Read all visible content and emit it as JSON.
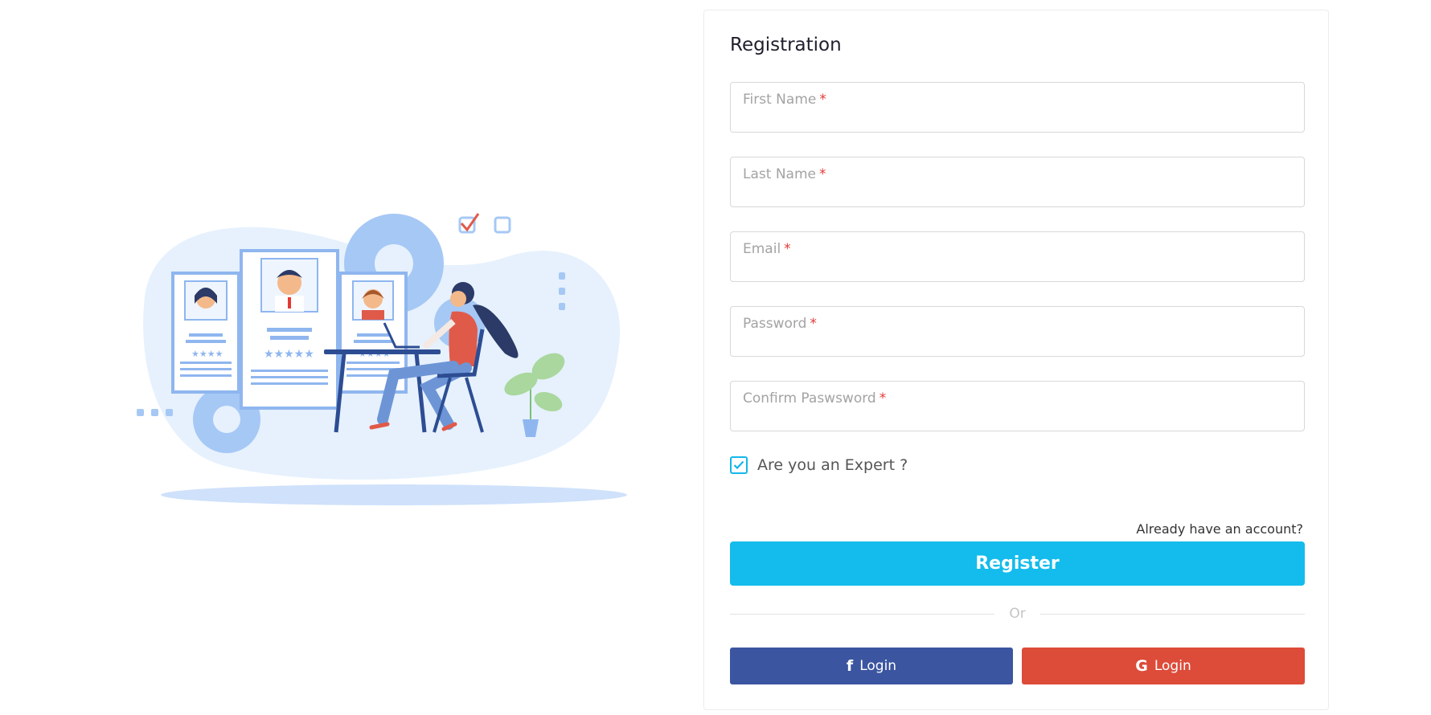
{
  "form": {
    "title": "Registration",
    "required_marker": "*",
    "fields": [
      {
        "label": "First Name",
        "value": "",
        "required": true
      },
      {
        "label": "Last Name",
        "value": "",
        "required": true
      },
      {
        "label": "Email",
        "value": "",
        "required": true
      },
      {
        "label": "Password",
        "value": "",
        "required": true
      },
      {
        "label": "Confirm Paswsword",
        "value": "",
        "required": true
      }
    ],
    "expert_checkbox": {
      "label": "Are you an Expert ?",
      "checked": true
    },
    "login_link": "Already have an account?",
    "register_button": "Register",
    "divider_text": "Or",
    "social": {
      "facebook": {
        "icon": "facebook-icon",
        "label": "Login",
        "color": "#3b55a0"
      },
      "google": {
        "icon": "google-icon",
        "label": "Login",
        "color": "#dd4b39"
      }
    }
  },
  "colors": {
    "accent": "#13bcec",
    "required": "#e53935",
    "illustration_blue": "#a6c8f5"
  }
}
